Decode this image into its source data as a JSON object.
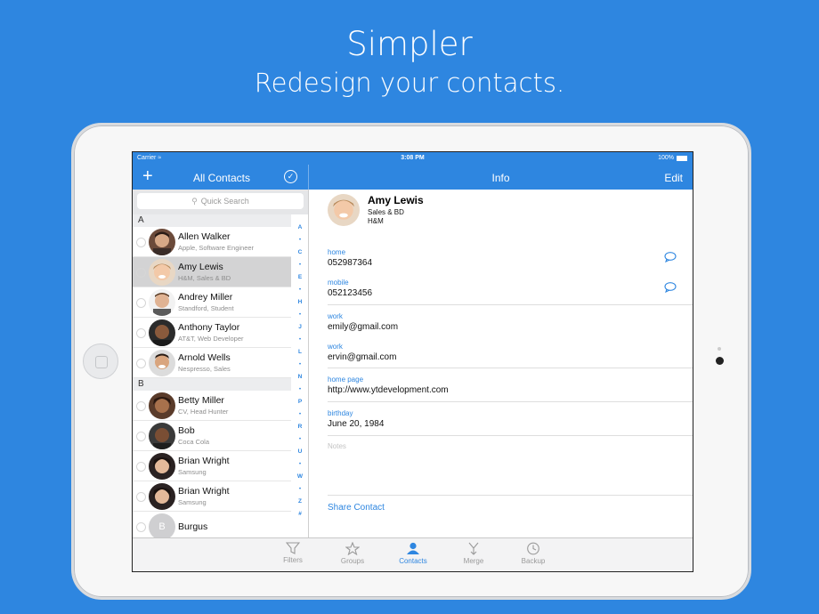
{
  "hero": {
    "title": "Simpler",
    "subtitle": "Redesign your contacts."
  },
  "statusbar": {
    "carrier": "Carrier",
    "time": "3:08 PM",
    "battery": "100%"
  },
  "navbar": {
    "add_label": "+",
    "left_title": "All Contacts",
    "center_title": "Info",
    "edit_label": "Edit"
  },
  "search": {
    "placeholder": "Quick Search"
  },
  "sections": [
    {
      "letter": "A",
      "contacts": [
        {
          "name": "Allen Walker",
          "subtitle": "Apple, Software Engineer",
          "selected": false
        },
        {
          "name": "Amy Lewis",
          "subtitle": "H&M, Sales & BD",
          "selected": true
        },
        {
          "name": "Andrey Miller",
          "subtitle": "Standford, Student",
          "selected": false
        },
        {
          "name": "Anthony Taylor",
          "subtitle": "AT&T, Web Developer",
          "selected": false
        },
        {
          "name": "Arnold Wells",
          "subtitle": "Nespresso, Sales",
          "selected": false
        }
      ]
    },
    {
      "letter": "B",
      "contacts": [
        {
          "name": "Betty Miller",
          "subtitle": "CV, Head Hunter",
          "selected": false
        },
        {
          "name": "Bob",
          "subtitle": "Coca Cola",
          "selected": false
        },
        {
          "name": "Brian Wright",
          "subtitle": "Samsung",
          "selected": false
        },
        {
          "name": "Brian Wright",
          "subtitle": "Samsung",
          "selected": false
        },
        {
          "name": "Burgus",
          "subtitle": "",
          "selected": false,
          "initial": "B"
        }
      ]
    }
  ],
  "index": [
    "A",
    "•",
    "C",
    "•",
    "E",
    "•",
    "H",
    "•",
    "J",
    "•",
    "L",
    "•",
    "N",
    "•",
    "P",
    "•",
    "R",
    "•",
    "U",
    "•",
    "W",
    "•",
    "Z",
    "#"
  ],
  "detail": {
    "name": "Amy Lewis",
    "department": "Sales & BD",
    "company": "H&M",
    "fields": [
      {
        "label": "home",
        "value": "052987364"
      },
      {
        "label": "mobile",
        "value": "052123456"
      },
      {
        "label": "work",
        "value": "emily@gmail.com"
      },
      {
        "label": "work",
        "value": "ervin@gmail.com"
      },
      {
        "label": "home page",
        "value": "http://www.ytdevelopment.com"
      },
      {
        "label": "birthday",
        "value": "June 20, 1984"
      }
    ],
    "notes_placeholder": "Notes",
    "share_label": "Share Contact"
  },
  "tabs": [
    {
      "label": "Filters",
      "icon": "filter-icon",
      "active": false
    },
    {
      "label": "Groups",
      "icon": "star-icon",
      "active": false
    },
    {
      "label": "Contacts",
      "icon": "person-icon",
      "active": true
    },
    {
      "label": "Merge",
      "icon": "merge-icon",
      "active": false
    },
    {
      "label": "Backup",
      "icon": "clock-icon",
      "active": false
    }
  ],
  "colors": {
    "accent": "#2e86e0",
    "background": "#2e86e0",
    "selected_row": "#d3d3d4"
  }
}
